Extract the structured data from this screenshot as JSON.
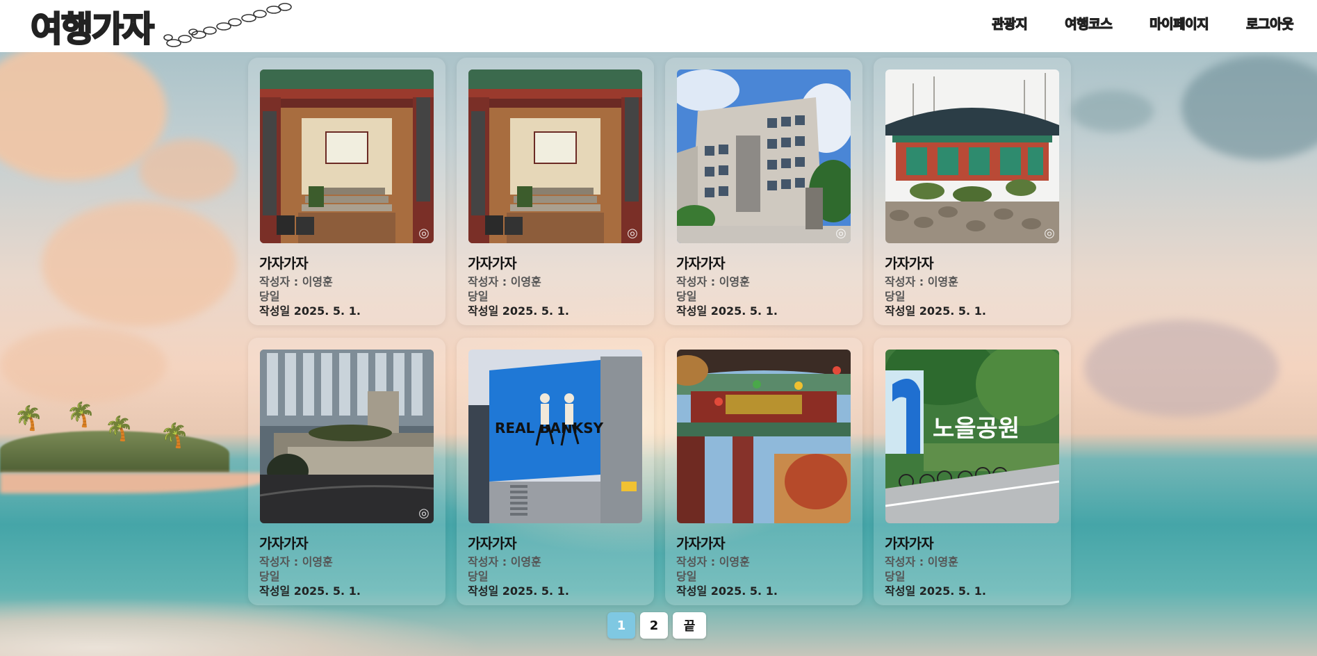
{
  "header": {
    "logo_text": "여행가자",
    "nav": [
      "관광지",
      "여행코스",
      "마이페이지",
      "로그아웃"
    ]
  },
  "cards": [
    {
      "title": "가자가자",
      "author": "작성자 : 이영훈",
      "duration": "당일",
      "date": "작성일 2025. 5. 1.",
      "image": "temple-gate-photo"
    },
    {
      "title": "가자가자",
      "author": "작성자 : 이영훈",
      "duration": "당일",
      "date": "작성일 2025. 5. 1.",
      "image": "temple-gate-photo"
    },
    {
      "title": "가자가자",
      "author": "작성자 : 이영훈",
      "duration": "당일",
      "date": "작성일 2025. 5. 1.",
      "image": "office-building-photo"
    },
    {
      "title": "가자가자",
      "author": "작성자 : 이영훈",
      "duration": "당일",
      "date": "작성일 2025. 5. 1.",
      "image": "hanok-pavilion-photo"
    },
    {
      "title": "가자가자",
      "author": "작성자 : 이영훈",
      "duration": "당일",
      "date": "작성일 2025. 5. 1.",
      "image": "city-building-photo"
    },
    {
      "title": "가자가자",
      "author": "작성자 : 이영훈",
      "duration": "당일",
      "date": "작성일 2025. 5. 1.",
      "image": "billboard-photo"
    },
    {
      "title": "가자가자",
      "author": "작성자 : 이영훈",
      "duration": "당일",
      "date": "작성일 2025. 5. 1.",
      "image": "temple-archway-photo"
    },
    {
      "title": "가자가자",
      "author": "작성자 : 이영훈",
      "duration": "당일",
      "date": "작성일 2025. 5. 1.",
      "image": "park-sign-photo"
    }
  ],
  "photo_text": {
    "banksy": "REAL BANKSY",
    "park_sign": "노을공원"
  },
  "pagination": {
    "pages": [
      "1",
      "2"
    ],
    "last_label": "끝",
    "current": "1"
  },
  "colors": {
    "active_page": "#7fc8e2",
    "header_bg": "#ffffff"
  }
}
